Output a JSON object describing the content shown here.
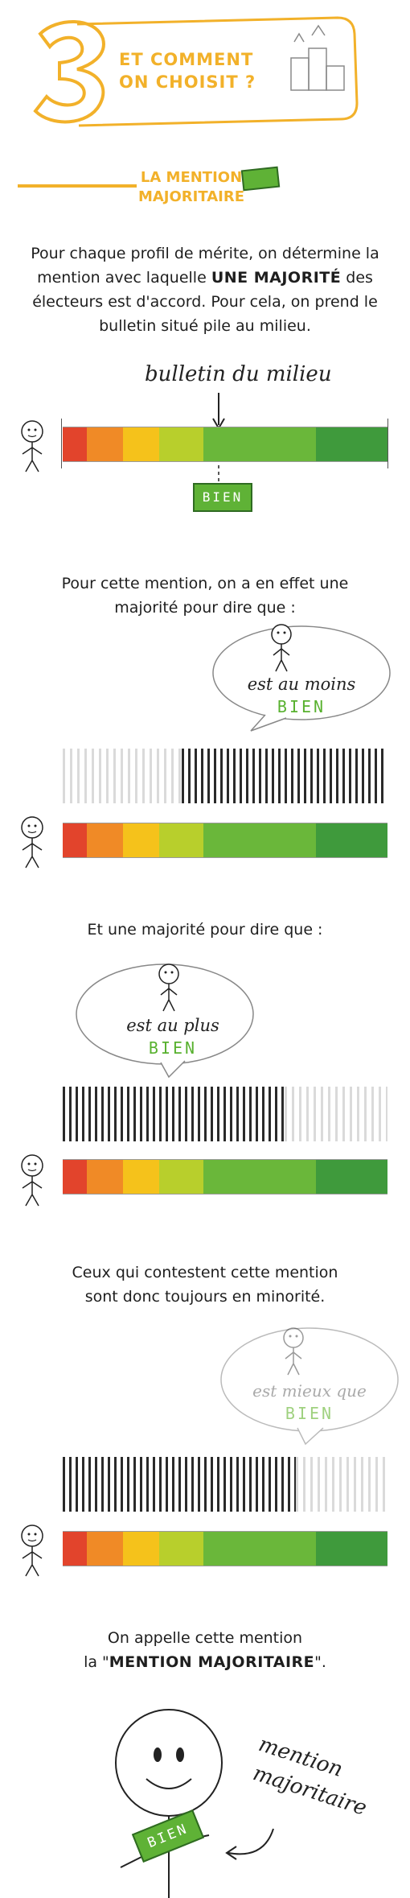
{
  "header": {
    "number": "3",
    "title_line1": "ET COMMENT",
    "title_line2": "ON CHOISIT ?"
  },
  "section": {
    "label_line1": "LA MENTION",
    "label_line2": "MAJORITAIRE"
  },
  "intro": {
    "part1": "Pour chaque profil de mérite, on détermine la mention avec laquelle ",
    "bold": "UNE MAJORITÉ",
    "part2": " des électeurs est d'accord. Pour cela, on prend le bulletin situé pile au milieu."
  },
  "panel1": {
    "annotation": "bulletin du milieu",
    "tag": "BIEN"
  },
  "para2": "Pour cette mention, on a en effet une majorité pour dire que :",
  "bubble1": {
    "line1": "est au moins",
    "line2": "BIEN"
  },
  "para3": "Et une majorité pour dire que :",
  "bubble2": {
    "line1": "est au plus",
    "line2": "BIEN"
  },
  "para4_line1": "Ceux qui contestent cette mention",
  "para4_line2": "sont donc toujours en minorité.",
  "bubble3": {
    "line1": "est mieux que",
    "line2": "BIEN"
  },
  "final": {
    "line1": "On appelle cette mention",
    "line2_prefix": "la \"",
    "line2_bold": "MENTION MAJORITAIRE",
    "line2_suffix": "\".",
    "annotation_line1": "mention",
    "annotation_line2": "majoritaire",
    "tag": "BIEN"
  },
  "colors": {
    "accent": "#f2b12a",
    "red": "#e2442c",
    "orange": "#f08a26",
    "yellow": "#f5c21b",
    "lime": "#b8cf2c",
    "green": "#6ab73a",
    "dark_green": "#3f9a3c"
  }
}
